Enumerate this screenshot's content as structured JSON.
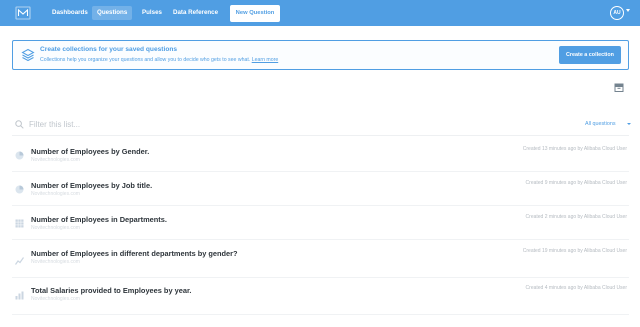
{
  "nav": {
    "links": [
      {
        "label": "Dashboards",
        "active": false
      },
      {
        "label": "Questions",
        "active": true
      },
      {
        "label": "Pulses",
        "active": false
      },
      {
        "label": "Data Reference",
        "active": false
      }
    ],
    "new_question": "New Question",
    "avatar": "AU"
  },
  "banner": {
    "title": "Create collections for your saved questions",
    "description": "Collections help you organize your questions and allow you to decide who gets to see what.",
    "learn_more": "Learn more",
    "button": "Create a collection"
  },
  "filter": {
    "placeholder": "Filter this list...",
    "scope": "All questions"
  },
  "questions": [
    {
      "title": "Number of Employees by Gender.",
      "subtitle": "Novitechnologies.com",
      "meta": "Created 13 minutes ago by Alibaba Cloud User",
      "icon": "pie-chart-icon"
    },
    {
      "title": "Number of Employees by Job title.",
      "subtitle": "Novitechnologies.com",
      "meta": "Created 9 minutes ago by Alibaba Cloud User",
      "icon": "pie-chart-icon"
    },
    {
      "title": "Number of Employees in Departments.",
      "subtitle": "Novitechnologies.com",
      "meta": "Created 2 minutes ago by Alibaba Cloud User",
      "icon": "table-icon"
    },
    {
      "title": "Number of Employees in different departments by gender?",
      "subtitle": "Novitechnologies.com",
      "meta": "Created 19 minutes ago by Alibaba Cloud User",
      "icon": "line-chart-icon"
    },
    {
      "title": "Total Salaries provided to Employees by year.",
      "subtitle": "Novitechnologies.com",
      "meta": "Created 4 minutes ago by Alibaba Cloud User",
      "icon": "bar-chart-icon"
    }
  ],
  "colors": {
    "brand": "#509ee3",
    "text": "#2e353b",
    "muted": "#b5bbc1"
  }
}
